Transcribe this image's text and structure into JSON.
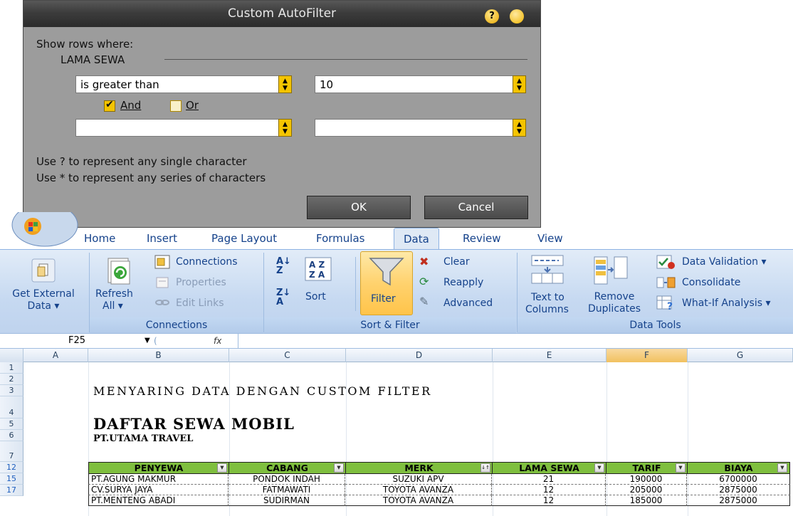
{
  "dialog": {
    "title": "Custom AutoFilter",
    "show_rows_where": "Show rows where:",
    "field_name": "LAMA SEWA",
    "criteria1": {
      "operator": "is greater than",
      "value": "10"
    },
    "criteria2": {
      "operator": "",
      "value": ""
    },
    "and_label": "And",
    "or_label": "Or",
    "and_checked": true,
    "hint1": "Use ? to represent any single character",
    "hint2": "Use * to represent any series of characters",
    "ok_label": "OK",
    "cancel_label": "Cancel"
  },
  "ribbon": {
    "tabs": [
      "Home",
      "Insert",
      "Page Layout",
      "Formulas",
      "Data",
      "Review",
      "View"
    ],
    "active_tab": "Data",
    "get_external_data": [
      "Get External",
      "Data ▾"
    ],
    "refresh_all": [
      "Refresh",
      "All ▾"
    ],
    "connections_items": [
      "Connections",
      "Properties",
      "Edit Links"
    ],
    "sort_label": "Sort",
    "filter_label": "Filter",
    "filter_items": [
      "Clear",
      "Reapply",
      "Advanced"
    ],
    "text_to_columns": [
      "Text to",
      "Columns"
    ],
    "remove_duplicates": [
      "Remove",
      "Duplicates"
    ],
    "data_tools_items": [
      "Data Validation ▾",
      "Consolidate",
      "What-If Analysis ▾"
    ],
    "groups": [
      "Connections",
      "Sort & Filter",
      "Data Tools"
    ]
  },
  "formula_bar": {
    "name_box": "F25",
    "fx": "fx",
    "content": ""
  },
  "sheet": {
    "columns": [
      "A",
      "B",
      "C",
      "D",
      "E",
      "F",
      "G"
    ],
    "selected_column": "F",
    "row_numbers": [
      "1",
      "2",
      "3",
      "4",
      "5",
      "6",
      "7",
      "12",
      "15",
      "17"
    ],
    "title": "MENYARING DATA DENGAN CUSTOM FILTER",
    "heading": "DAFTAR SEWA MOBIL",
    "subheading": "PT.UTAMA TRAVEL",
    "table": {
      "headers": [
        "PENYEWA",
        "CABANG",
        "MERK",
        "LAMA SEWA",
        "TARIF",
        "BIAYA"
      ],
      "rows": [
        [
          "PT.AGUNG MAKMUR",
          "PONDOK INDAH",
          "SUZUKI APV",
          "21",
          "190000",
          "6700000"
        ],
        [
          "CV.SURYA JAYA",
          "FATMAWATI",
          "TOYOTA AVANZA",
          "12",
          "205000",
          "2875000"
        ],
        [
          "PT.MENTENG ABADI",
          "SUDIRMAN",
          "TOYOTA AVANZA",
          "12",
          "185000",
          "2875000"
        ]
      ]
    }
  },
  "colors": {
    "header_green": "#7fbf3f",
    "accent_yellow": "#f4c400",
    "ribbon_blue": "#c6d9f1",
    "label_blue": "#15428b"
  }
}
